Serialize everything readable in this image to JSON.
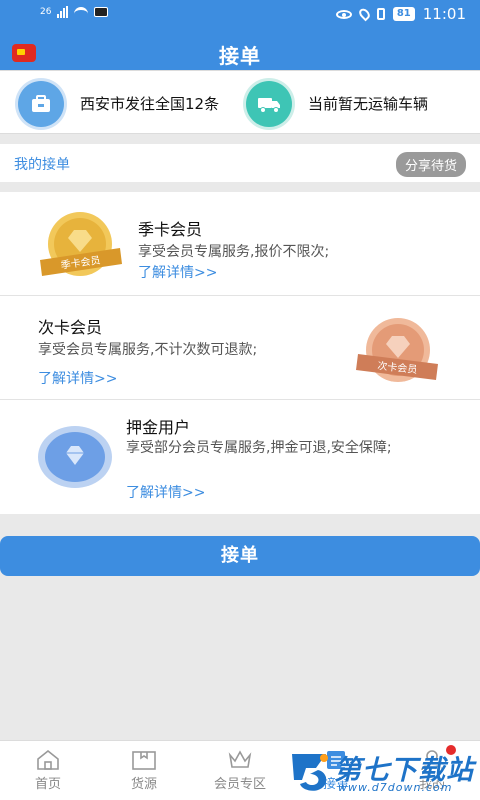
{
  "status_bar": {
    "network": "26",
    "battery": "81",
    "time": "11:01"
  },
  "header": {
    "title": "接单"
  },
  "info": {
    "route": "西安市发往全国12条",
    "vehicle": "当前暂无运输车辆"
  },
  "my_orders": {
    "label": "我的接单",
    "share_button": "分享待货"
  },
  "memberships": [
    {
      "title": "季卡会员",
      "description": "享受会员专属服务,报价不限次;",
      "link": "了解详情>>",
      "badge_text": "季卡会员"
    },
    {
      "title": "次卡会员",
      "description": "享受会员专属服务,不计次数可退款;",
      "link": "了解详情>>",
      "badge_text": "次卡会员"
    },
    {
      "title": "押金用户",
      "description": "享受部分会员专属服务,押金可退,安全保障;",
      "link": "了解详情>>"
    }
  ],
  "primary_button": "接单",
  "tabs": [
    {
      "label": "首页",
      "icon": "home-icon"
    },
    {
      "label": "货源",
      "icon": "cargo-icon"
    },
    {
      "label": "会员专区",
      "icon": "crown-icon"
    },
    {
      "label": "接单",
      "icon": "order-icon"
    },
    {
      "label": "我的",
      "icon": "user-icon"
    }
  ],
  "watermark": {
    "name": "第七下载站",
    "url": "www.d7down.com"
  },
  "colors": {
    "primary": "#3d8de0",
    "gold": "#e7b33c",
    "copper": "#e49b77",
    "diamond": "#6d9fe6"
  }
}
